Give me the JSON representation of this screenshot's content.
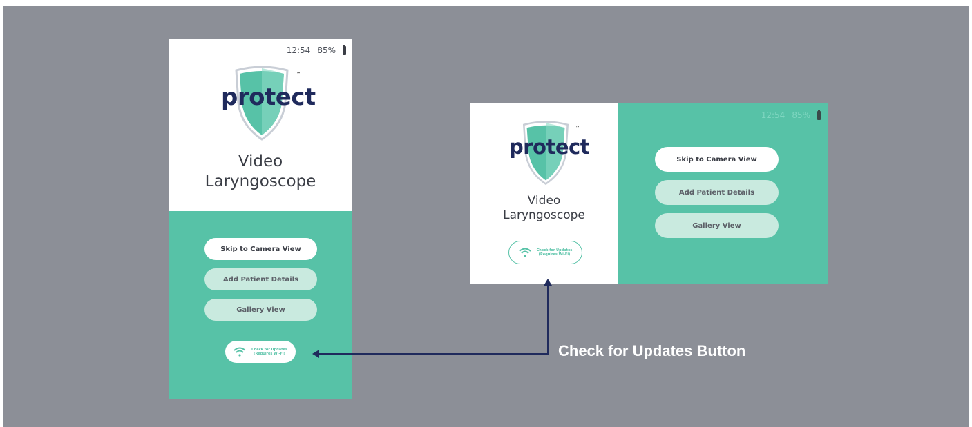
{
  "status": {
    "time": "12:54",
    "battery": "85%"
  },
  "logo": {
    "word": "protect",
    "tm": "™"
  },
  "app_title": {
    "line1": "Video",
    "line2": "Laryngoscope"
  },
  "buttons": {
    "skip": "Skip to Camera View",
    "add_patient": "Add Patient Details",
    "gallery": "Gallery View"
  },
  "update_button": {
    "line1": "Check for Updates",
    "line2": "(Requires Wi-Fi)",
    "icon": "wifi-icon"
  },
  "annotation": {
    "label": "Check for Updates Button"
  },
  "colors": {
    "teal": "#57c2a7",
    "light_teal": "#c9eadf",
    "navy": "#1f2a5c",
    "backdrop": "#8c8f97"
  }
}
